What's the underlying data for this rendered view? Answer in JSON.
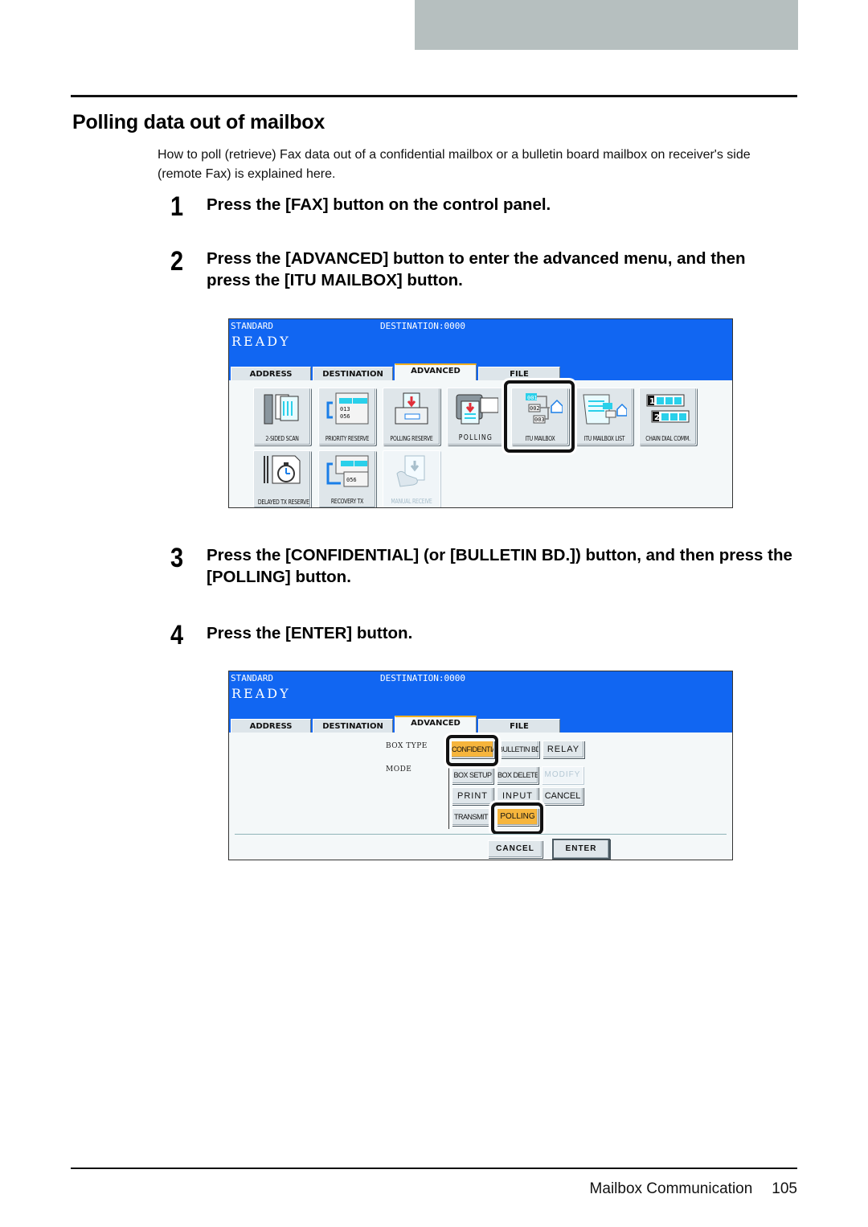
{
  "page": {
    "title": "Polling data out of mailbox",
    "intro": "How to poll (retrieve) Fax data out of a confidential mailbox or a bulletin board mailbox on receiver's side (remote Fax) is explained here.",
    "steps": [
      {
        "num": "1",
        "text": "Press the [FAX] button on the control panel."
      },
      {
        "num": "2",
        "text": "Press the [ADVANCED] button to enter the advanced menu, and then press the [ITU MAILBOX] button."
      },
      {
        "num": "3",
        "text": "Press the [CONFIDENTIAL] (or [BULLETIN BD.]) button, and then press the [POLLING] button."
      },
      {
        "num": "4",
        "text": "Press the [ENTER] button."
      }
    ],
    "footer": {
      "section": "Mailbox Communication",
      "page_number": "105"
    }
  },
  "screen1": {
    "status_mode": "STANDARD",
    "destination": "DESTINATION:0000",
    "state": "READY",
    "tabs": [
      {
        "label": "ADDRESS",
        "active": false
      },
      {
        "label": "DESTINATION",
        "active": false
      },
      {
        "label": "ADVANCED",
        "active": true
      },
      {
        "label": "FILE",
        "active": false
      }
    ],
    "buttons": [
      {
        "label": "2-SIDED SCAN",
        "icon": "duplex-scan-icon"
      },
      {
        "label": "PRIORITY RESERVE",
        "icon": "priority-reserve-icon"
      },
      {
        "label": "POLLING RESERVE",
        "icon": "polling-reserve-icon"
      },
      {
        "label": "POLLING",
        "icon": "polling-icon"
      },
      {
        "label": "ITU MAILBOX",
        "icon": "itu-mailbox-icon",
        "highlighted": true
      },
      {
        "label": "ITU MAILBOX LIST",
        "icon": "itu-mailbox-list-icon"
      },
      {
        "label": "CHAIN DIAL COMM.",
        "icon": "chain-dial-icon"
      },
      {
        "label": "DELAYED TX RESERVE",
        "icon": "delayed-tx-icon"
      },
      {
        "label": "RECOVERY TX",
        "icon": "recovery-tx-icon"
      },
      {
        "label": "MANUAL RECEIVE",
        "icon": "manual-receive-icon",
        "disabled": true
      }
    ]
  },
  "screen2": {
    "status_mode": "STANDARD",
    "destination": "DESTINATION:0000",
    "state": "READY",
    "tabs": [
      {
        "label": "ADDRESS",
        "active": false
      },
      {
        "label": "DESTINATION",
        "active": false
      },
      {
        "label": "ADVANCED",
        "active": true
      },
      {
        "label": "FILE",
        "active": false
      }
    ],
    "box_type_label": "BOX TYPE",
    "mode_label": "MODE",
    "box_types": [
      {
        "label": "CONFIDENTIAL",
        "selected": true
      },
      {
        "label": "BULLETIN BD.",
        "selected": false
      },
      {
        "label": "RELAY",
        "selected": false
      }
    ],
    "modes": [
      {
        "label": "BOX SETUP"
      },
      {
        "label": "BOX DELETE"
      },
      {
        "label": "MODIFY",
        "disabled": true
      },
      {
        "label": "PRINT"
      },
      {
        "label": "INPUT"
      },
      {
        "label": "CANCEL"
      },
      {
        "label": "TRANSMIT"
      },
      {
        "label": "POLLING",
        "selected": true
      }
    ],
    "cancel_label": "CANCEL",
    "enter_label": "ENTER"
  },
  "colors": {
    "lcd_header": "#1166f2",
    "selected_button": "#f6b53c",
    "header_block": "#b6bfbf"
  }
}
